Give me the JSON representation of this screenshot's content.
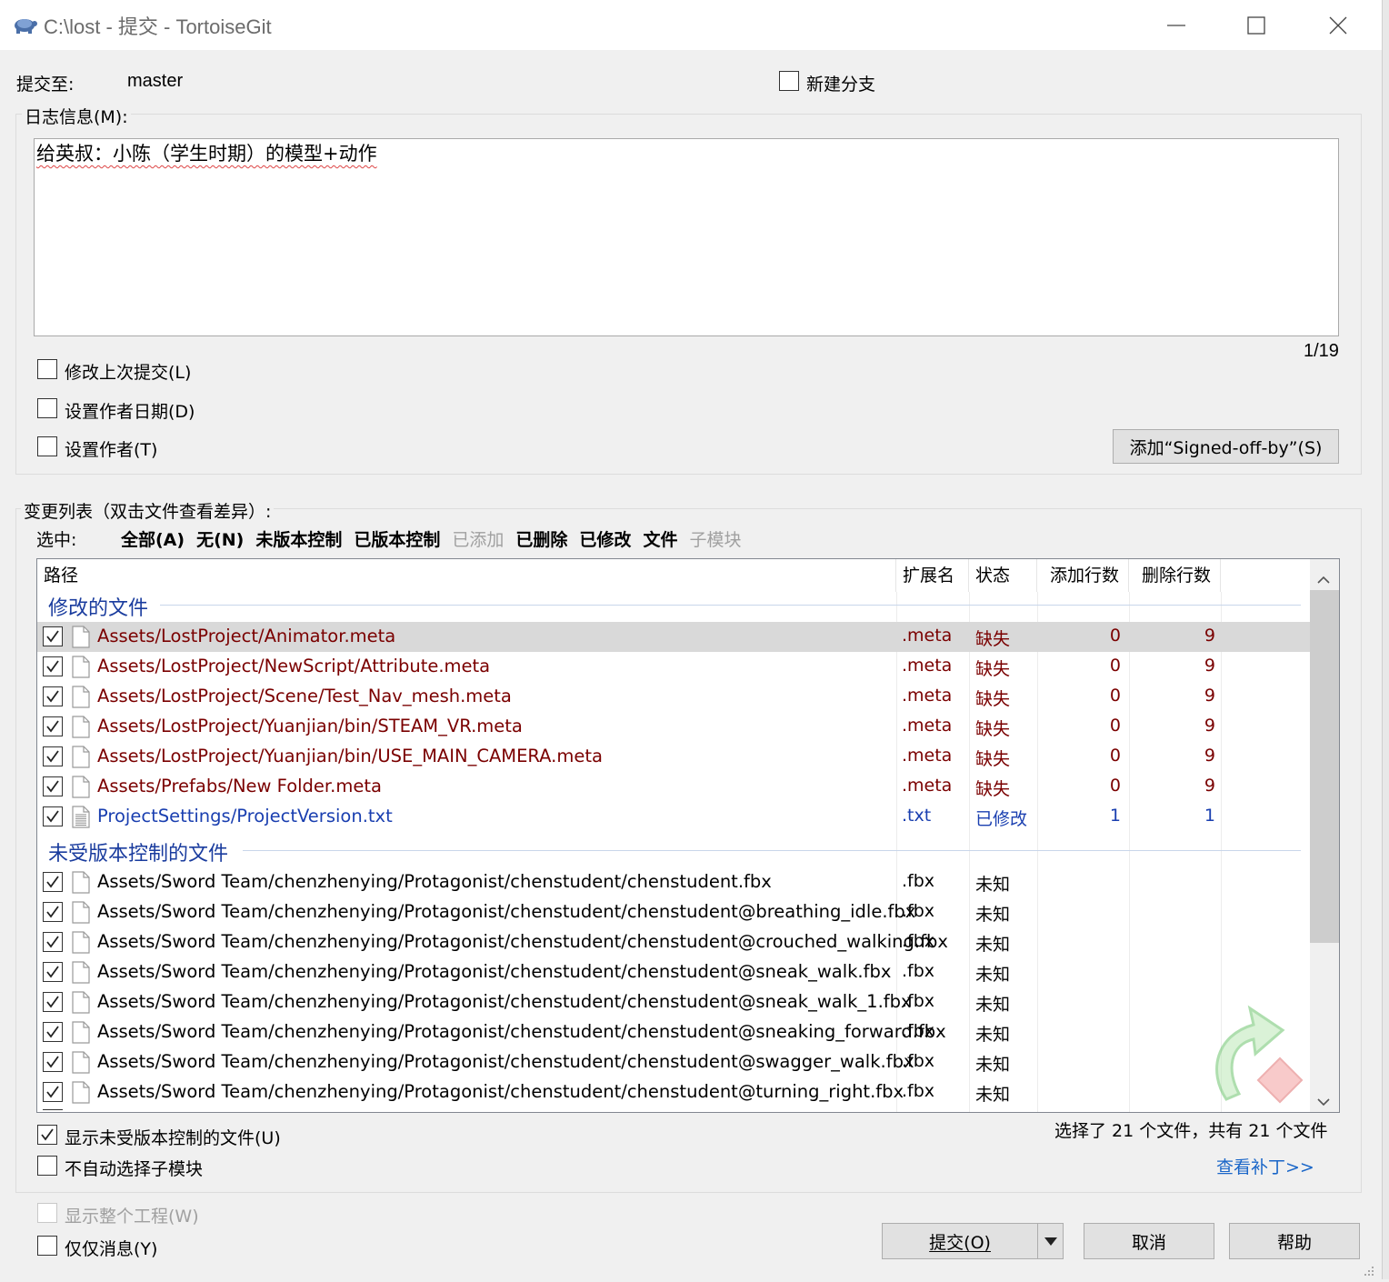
{
  "window": {
    "title": "C:\\lost - 提交 - TortoiseGit",
    "icon": "tortoise-icon"
  },
  "commit_to": {
    "label": "提交至:",
    "branch": "master"
  },
  "new_branch": {
    "label": "新建分支",
    "checked": false
  },
  "log_message": {
    "group_label": "日志信息(M):",
    "text": "给英叔：小陈（学生时期）的模型+动作",
    "position": "1/19"
  },
  "options": {
    "amend": "修改上次提交(L)",
    "set_date": "设置作者日期(D)",
    "set_author": "设置作者(T)",
    "signed_off_button": "添加“Signed-off-by”(S)"
  },
  "changes": {
    "group_label": "变更列表（双击文件查看差异）:",
    "select_label": "选中:",
    "filters": [
      {
        "label": "全部(A)",
        "enabled": true
      },
      {
        "label": "无(N)",
        "enabled": true
      },
      {
        "label": "未版本控制",
        "enabled": true
      },
      {
        "label": "已版本控制",
        "enabled": true
      },
      {
        "label": "已添加",
        "enabled": false
      },
      {
        "label": "已删除",
        "enabled": true
      },
      {
        "label": "已修改",
        "enabled": true
      },
      {
        "label": "文件",
        "enabled": true
      },
      {
        "label": "子模块",
        "enabled": false
      }
    ],
    "columns": {
      "path": "路径",
      "ext": "扩展名",
      "status": "状态",
      "added": "添加行数",
      "deleted": "删除行数"
    },
    "modified_group": "修改的文件",
    "modified_files": [
      {
        "path": "Assets/LostProject/Animator.meta",
        "ext": ".meta",
        "status": "缺失",
        "added": "0",
        "deleted": "9",
        "kind": "missing",
        "checked": true,
        "selected": true
      },
      {
        "path": "Assets/LostProject/NewScript/Attribute.meta",
        "ext": ".meta",
        "status": "缺失",
        "added": "0",
        "deleted": "9",
        "kind": "missing",
        "checked": true
      },
      {
        "path": "Assets/LostProject/Scene/Test_Nav_mesh.meta",
        "ext": ".meta",
        "status": "缺失",
        "added": "0",
        "deleted": "9",
        "kind": "missing",
        "checked": true
      },
      {
        "path": "Assets/LostProject/Yuanjian/bin/STEAM_VR.meta",
        "ext": ".meta",
        "status": "缺失",
        "added": "0",
        "deleted": "9",
        "kind": "missing",
        "checked": true
      },
      {
        "path": "Assets/LostProject/Yuanjian/bin/USE_MAIN_CAMERA.meta",
        "ext": ".meta",
        "status": "缺失",
        "added": "0",
        "deleted": "9",
        "kind": "missing",
        "checked": true
      },
      {
        "path": "Assets/Prefabs/New Folder.meta",
        "ext": ".meta",
        "status": "缺失",
        "added": "0",
        "deleted": "9",
        "kind": "missing",
        "checked": true
      },
      {
        "path": "ProjectSettings/ProjectVersion.txt",
        "ext": ".txt",
        "status": "已修改",
        "added": "1",
        "deleted": "1",
        "kind": "modified",
        "checked": true
      }
    ],
    "unversioned_group": "未受版本控制的文件",
    "unversioned_files": [
      {
        "path": "Assets/Sword Team/chenzhenying/Protagonist/chenstudent/chenstudent.fbx",
        "ext": ".fbx",
        "status": "未知",
        "checked": true
      },
      {
        "path": "Assets/Sword Team/chenzhenying/Protagonist/chenstudent/chenstudent@breathing_idle.fbx",
        "ext": ".fbx",
        "status": "未知",
        "checked": true
      },
      {
        "path": "Assets/Sword Team/chenzhenying/Protagonist/chenstudent/chenstudent@crouched_walking.fbx",
        "ext": ".fbx",
        "status": "未知",
        "checked": true
      },
      {
        "path": "Assets/Sword Team/chenzhenying/Protagonist/chenstudent/chenstudent@sneak_walk.fbx",
        "ext": ".fbx",
        "status": "未知",
        "checked": true
      },
      {
        "path": "Assets/Sword Team/chenzhenying/Protagonist/chenstudent/chenstudent@sneak_walk_1.fbx",
        "ext": ".fbx",
        "status": "未知",
        "checked": true
      },
      {
        "path": "Assets/Sword Team/chenzhenying/Protagonist/chenstudent/chenstudent@sneaking_forward.fbx",
        "ext": ".fbx",
        "status": "未知",
        "checked": true
      },
      {
        "path": "Assets/Sword Team/chenzhenying/Protagonist/chenstudent/chenstudent@swagger_walk.fbx",
        "ext": ".fbx",
        "status": "未知",
        "checked": true
      },
      {
        "path": "Assets/Sword Team/chenzhenying/Protagonist/chenstudent/chenstudent@turning_right.fbx",
        "ext": ".fbx",
        "status": "未知",
        "checked": true
      }
    ],
    "selection_summary": "选择了 21 个文件，共有 21 个文件",
    "view_patch": "查看补丁>>",
    "show_unversioned": {
      "label": "显示未受版本控制的文件(U)",
      "checked": true
    },
    "no_auto_submodule": {
      "label": "不自动选择子模块",
      "checked": false
    }
  },
  "footer": {
    "whole_project": {
      "label": "显示整个工程(W)",
      "enabled": false
    },
    "message_only": {
      "label": "仅仅消息(Y)",
      "checked": false
    },
    "commit_button": "提交(O)",
    "cancel_button": "取消",
    "help_button": "帮助"
  },
  "colors": {
    "missing": "#7a0000",
    "modified": "#1a3fb0",
    "group_header": "#1a3c9e",
    "link": "#1a66c8"
  }
}
